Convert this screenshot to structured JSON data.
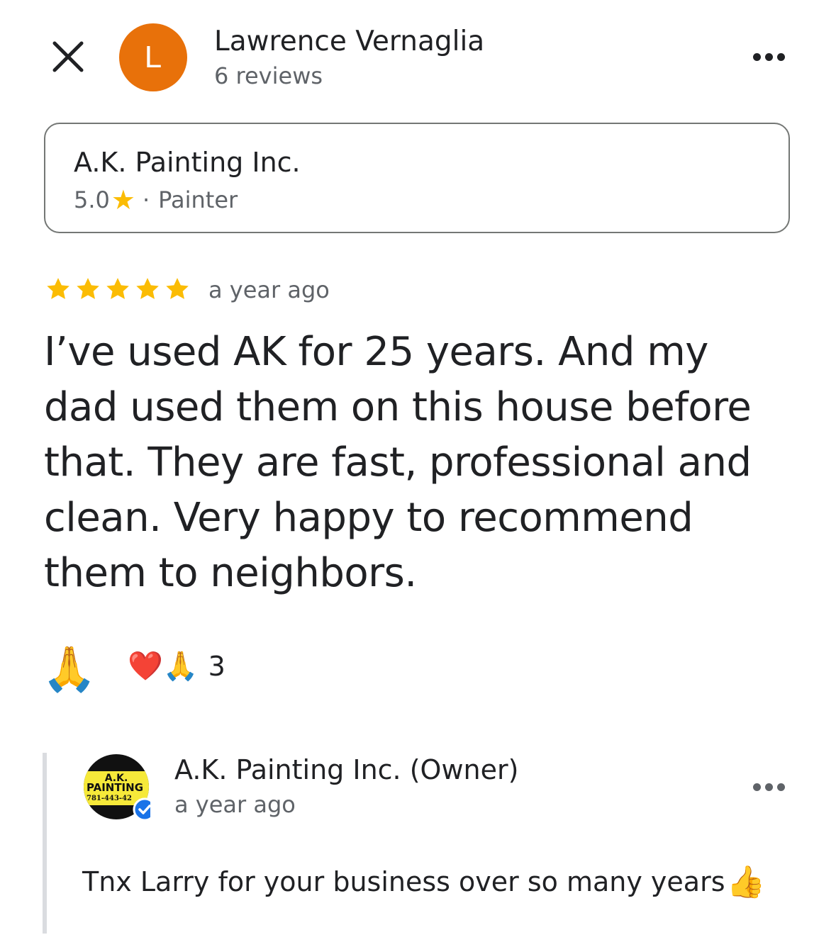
{
  "header": {
    "close_icon": "close-icon",
    "avatar_letter": "L",
    "avatar_color": "#e8710a",
    "reviewer_name": "Lawrence Vernaglia",
    "review_count": "6 reviews",
    "more_icon": "more-horizontal-icon"
  },
  "place": {
    "name": "A.K. Painting Inc.",
    "rating": "5.0",
    "star_icon": "star-icon",
    "separator": "·",
    "category": "Painter"
  },
  "review": {
    "stars": 5,
    "star_color": "#fbbc04",
    "date": "a year ago",
    "text": "I’ve used AK for 25 years. And my dad used them on this house before that. They are fast, professional and clean. Very happy to recommend them to neighbors."
  },
  "reactions": {
    "react_emoji": "🙏",
    "summary_emojis": "❤️🙏",
    "count": "3"
  },
  "owner_response": {
    "name": "A.K. Painting Inc. (Owner)",
    "date": "a year ago",
    "text": "Tnx Larry for your business over so many years",
    "emoji": "👍",
    "logo_text_line1": "A.K.",
    "logo_text_line2": "PAINTING",
    "logo_text_line3": "781-443-42",
    "verified_icon": "verified-badge-icon",
    "more_icon": "more-horizontal-icon"
  }
}
